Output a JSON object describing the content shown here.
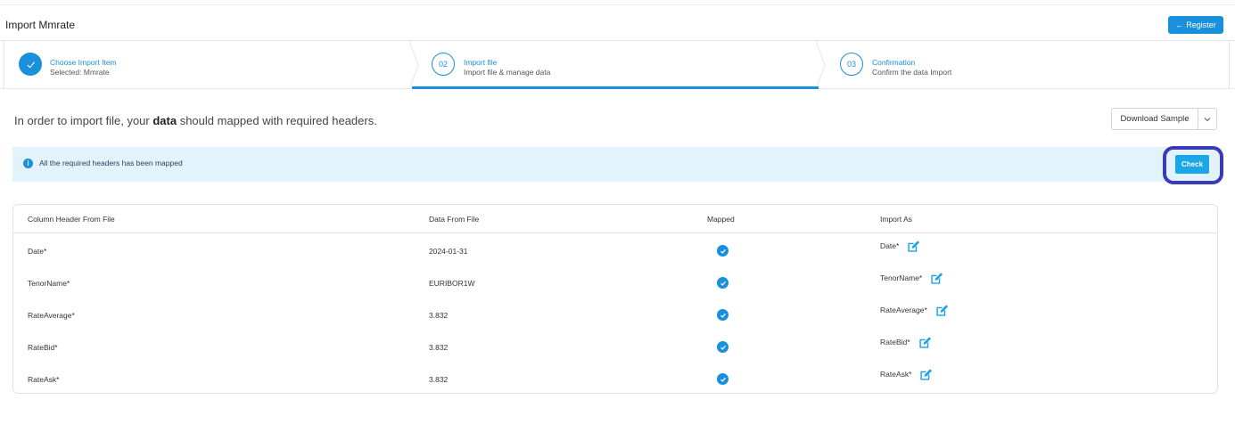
{
  "page": {
    "title": "Import Mmrate"
  },
  "header": {
    "register_label": "Register"
  },
  "steps": [
    {
      "title": "Choose Import Item",
      "subtitle": "Selected: Mmrate",
      "state": "done"
    },
    {
      "number": "02",
      "title": "Import file",
      "subtitle": "Import file & manage data",
      "state": "active"
    },
    {
      "number": "03",
      "title": "Confirmation",
      "subtitle": "Confirm the data Import",
      "state": "pending"
    }
  ],
  "instruction": {
    "before": "In order to import file, your ",
    "bold": "data",
    "after": " should mapped with required headers."
  },
  "download": {
    "label": "Download Sample"
  },
  "alert": {
    "text": "All the required headers has been mapped"
  },
  "check": {
    "label": "Check"
  },
  "table": {
    "headers": [
      "Column Header From File",
      "Data From File",
      "Mapped",
      "Import As"
    ],
    "rows": [
      {
        "column": "Date*",
        "data": "2024-01-31",
        "mapped": true,
        "import_as": "Date*"
      },
      {
        "column": "TenorName*",
        "data": "EURIBOR1W",
        "mapped": true,
        "import_as": "TenorName*"
      },
      {
        "column": "RateAverage*",
        "data": "3.832",
        "mapped": true,
        "import_as": "RateAverage*"
      },
      {
        "column": "RateBid*",
        "data": "3.832",
        "mapped": true,
        "import_as": "RateBid*"
      },
      {
        "column": "RateAsk*",
        "data": "3.832",
        "mapped": true,
        "import_as": "RateAsk*"
      }
    ]
  },
  "colors": {
    "accent": "#1a8fdc",
    "alert_bg": "#e3f3fc",
    "highlight_ring": "#3a3ab8"
  }
}
